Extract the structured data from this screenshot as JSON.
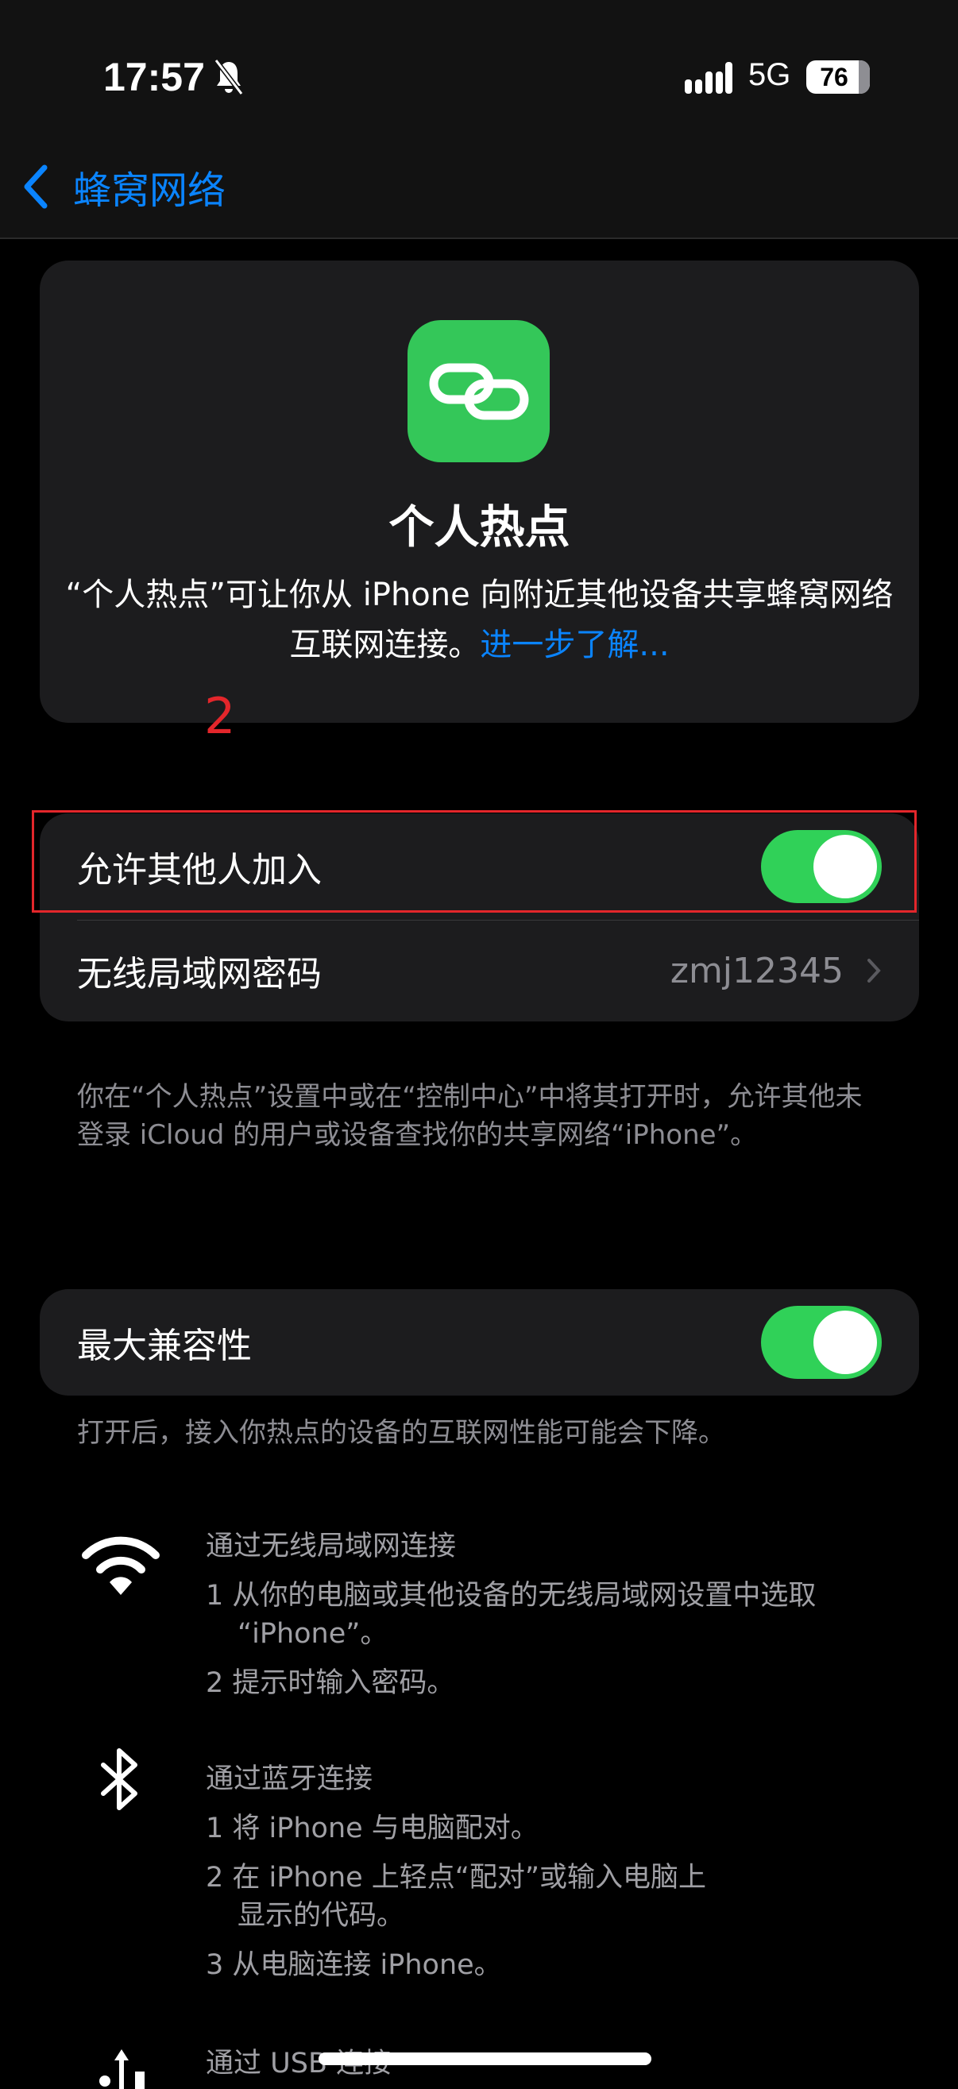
{
  "status": {
    "time": "17:57",
    "network": "5G",
    "battery": "76",
    "icons": [
      "bell-slash-icon",
      "cellular-signal-icon"
    ]
  },
  "nav": {
    "back_label": "蜂窝网络"
  },
  "hero": {
    "icon": "link-icon",
    "title": "个人热点",
    "description": "“个人热点”可让你从 iPhone 向附近其他设备共享蜂窝网络互联网连接。",
    "learn_more": "进一步了解..."
  },
  "annotation": {
    "mark": "2",
    "color": "#e3262b"
  },
  "group1": {
    "allow_others": {
      "label": "允许其他人加入",
      "on": true
    },
    "wifi_password": {
      "label": "无线局域网密码",
      "value": "zmj12345"
    }
  },
  "group1_footer": "你在“个人热点”设置中或在“控制中心”中将其打开时，允许其他未登录 iCloud 的用户或设备查找你的共享网络“iPhone”。",
  "group2": {
    "max_compat": {
      "label": "最大兼容性",
      "on": true
    }
  },
  "group2_footer": "打开后，接入你热点的设备的互联网性能可能会下降。",
  "wifi_section": {
    "icon": "wifi-icon",
    "title": "通过无线局域网连接",
    "step1": "1 从你的电脑或其他设备的无线局域网设置中选取",
    "step1b": "“iPhone”。",
    "step2": "2 提示时输入密码。"
  },
  "bt_section": {
    "icon": "bluetooth-icon",
    "title": "通过蓝牙连接",
    "step1": "1 将 iPhone 与电脑配对。",
    "step2": "2 在 iPhone 上轻点“配对”或输入电脑上",
    "step2b": "显示的代码。",
    "step3": "3 从电脑连接 iPhone。"
  },
  "usb_section": {
    "icon": "usb-icon",
    "title": "通过 USB 连接"
  },
  "colors": {
    "accent": "#0a84ff",
    "toggle_on": "#30d158",
    "app_icon": "#34c759"
  }
}
